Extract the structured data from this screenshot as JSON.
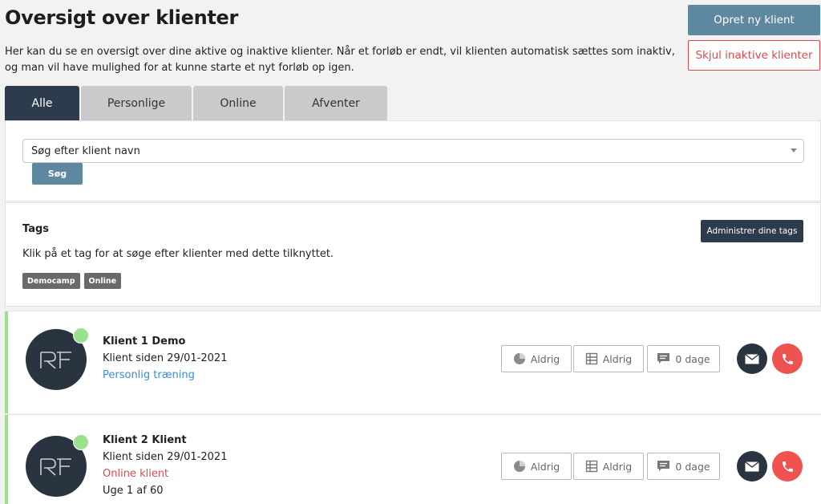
{
  "header": {
    "title": "Oversigt over klienter",
    "intro": "Her kan du se en oversigt over dine aktive og inaktive klienter. Når et forløb er endt, vil klienten automatisk sættes som inaktiv, og man vil have mulighed for at kunne starte et nyt forløb op igen.",
    "create_label": "Opret ny klient",
    "hide_inactive_label": "Skjul inaktive klienter"
  },
  "tabs": [
    {
      "label": "Alle",
      "active": true
    },
    {
      "label": "Personlige",
      "active": false
    },
    {
      "label": "Online",
      "active": false
    },
    {
      "label": "Afventer",
      "active": false
    }
  ],
  "search": {
    "value": "Søg efter klient navn",
    "button_label": "Søg"
  },
  "tags": {
    "title": "Tags",
    "help": "Klik på et tag for at søge efter klienter med dette tilknyttet.",
    "manage_label": "Administrer dine tags",
    "items": [
      "Democamp",
      "Online"
    ]
  },
  "clients": [
    {
      "name": "Klient 1 Demo",
      "since": "Klient siden 29/01-2021",
      "type": "Personlig træning",
      "week": "",
      "stat_a": "Aldrig",
      "stat_b": "Aldrig",
      "stat_c": "0 dage",
      "status_color": "#9be08f",
      "type_color": "#3a8dd8"
    },
    {
      "name": "Klient 2 Klient",
      "since": "Klient siden 29/01-2021",
      "type": "Online klient",
      "week": "Uge 1 af 60",
      "stat_a": "Aldrig",
      "stat_b": "Aldrig",
      "stat_c": "0 dage",
      "status_color": "#9be08f",
      "type_color": "#e0484a"
    }
  ],
  "icons": {
    "stat_a": "pie-chart-icon",
    "stat_b": "table-grid-icon",
    "stat_c": "chat-bubble-icon",
    "mail": "envelope-icon",
    "phone": "phone-icon",
    "avatar": "logo-icon"
  },
  "colors": {
    "primary": "#5e87a0",
    "dark": "#2c3c4d",
    "danger": "#e0484a",
    "online": "#9be08f",
    "link": "#3a8dd8"
  }
}
